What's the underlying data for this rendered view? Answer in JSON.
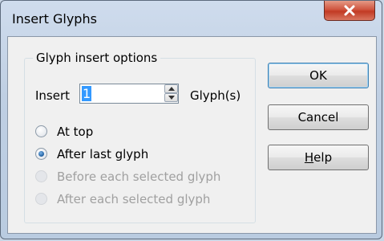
{
  "window": {
    "title": "Insert Glyphs"
  },
  "group": {
    "legend": "Glyph insert options",
    "insert_label": "Insert",
    "insert_value": "1",
    "unit_label": "Glyph(s)"
  },
  "options": [
    {
      "label": "At top",
      "selected": false,
      "enabled": true
    },
    {
      "label": "After last glyph",
      "selected": true,
      "enabled": true
    },
    {
      "label": "Before each selected glyph",
      "selected": false,
      "enabled": false
    },
    {
      "label": "After each selected glyph",
      "selected": false,
      "enabled": false
    }
  ],
  "buttons": {
    "ok": "OK",
    "cancel": "Cancel",
    "help_first": "H",
    "help_rest": "elp"
  },
  "colors": {
    "accent": "#3399ff",
    "close": "#c13a24",
    "disabled_text": "#a0a0a0"
  }
}
